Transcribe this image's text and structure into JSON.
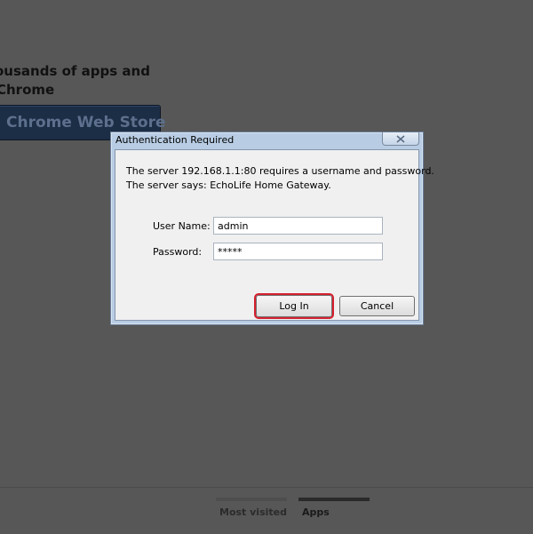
{
  "background": {
    "promo_line_1": "ousands of apps and",
    "promo_line_2": "Chrome",
    "webstore_button": "Chrome Web Store",
    "tabs": [
      {
        "label": "Most visited"
      },
      {
        "label": "Apps"
      }
    ]
  },
  "dialog": {
    "title": "Authentication Required",
    "close_icon": "close-icon",
    "message_line_1": "The server 192.168.1.1:80 requires a username and password.",
    "message_line_2": "The server says: EchoLife Home Gateway.",
    "username_label": "User Name:",
    "username_value": "admin",
    "password_label": "Password:",
    "password_value": "*****",
    "login_label": "Log In",
    "cancel_label": "Cancel",
    "highlight_color": "#d6202e"
  }
}
